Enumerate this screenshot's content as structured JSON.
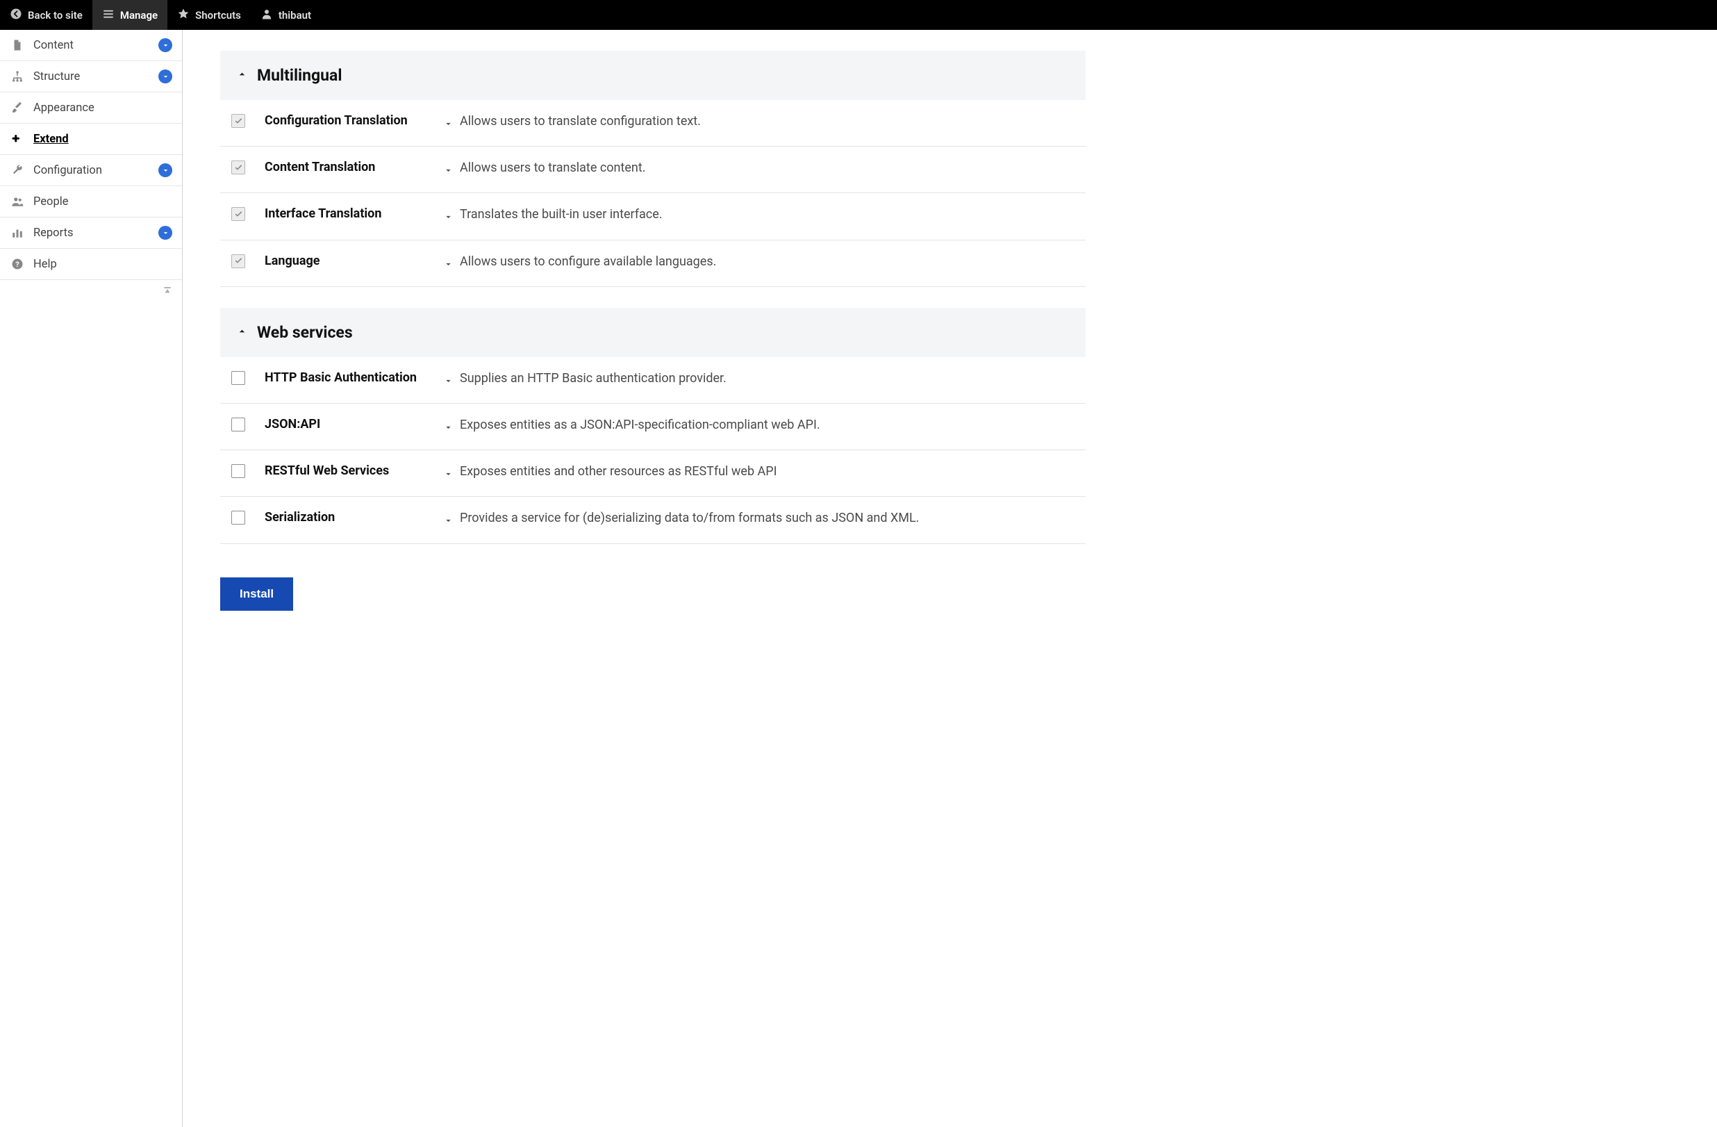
{
  "toolbar": {
    "back": "Back to site",
    "manage": "Manage",
    "shortcuts": "Shortcuts",
    "user": "thibaut"
  },
  "sidebar": {
    "items": [
      {
        "label": "Content",
        "expandable": true
      },
      {
        "label": "Structure",
        "expandable": true
      },
      {
        "label": "Appearance",
        "expandable": false
      },
      {
        "label": "Extend",
        "expandable": false,
        "active": true
      },
      {
        "label": "Configuration",
        "expandable": true
      },
      {
        "label": "People",
        "expandable": false
      },
      {
        "label": "Reports",
        "expandable": true
      },
      {
        "label": "Help",
        "expandable": false
      }
    ]
  },
  "sections": [
    {
      "title": "Multilingual",
      "modules": [
        {
          "name": "Configuration Translation",
          "desc": "Allows users to translate configuration text.",
          "checked": true,
          "disabled": true
        },
        {
          "name": "Content Translation",
          "desc": "Allows users to translate content.",
          "checked": true,
          "disabled": true
        },
        {
          "name": "Interface Translation",
          "desc": "Translates the built-in user interface.",
          "checked": true,
          "disabled": true
        },
        {
          "name": "Language",
          "desc": "Allows users to configure available languages.",
          "checked": true,
          "disabled": true
        }
      ]
    },
    {
      "title": "Web services",
      "modules": [
        {
          "name": "HTTP Basic Authentication",
          "desc": "Supplies an HTTP Basic authentication provider.",
          "checked": false,
          "disabled": false
        },
        {
          "name": "JSON:API",
          "desc": "Exposes entities as a JSON:API-specification-compliant web API.",
          "checked": false,
          "disabled": false
        },
        {
          "name": "RESTful Web Services",
          "desc": "Exposes entities and other resources as RESTful web API",
          "checked": false,
          "disabled": false
        },
        {
          "name": "Serialization",
          "desc": "Provides a service for (de)serializing data to/from formats such as JSON and XML.",
          "checked": false,
          "disabled": false
        }
      ]
    }
  ],
  "actions": {
    "install": "Install"
  }
}
